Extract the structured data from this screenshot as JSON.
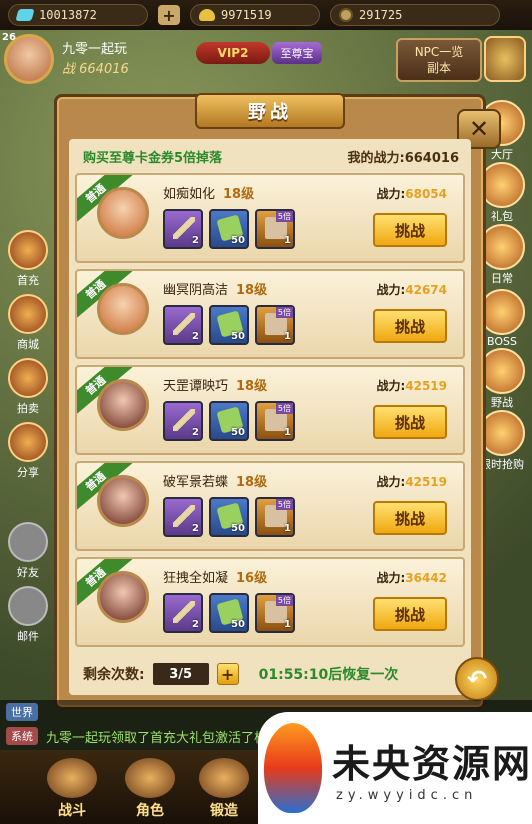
{
  "topbar": {
    "gems": "10013872",
    "gold": "9971519",
    "copper": "291725"
  },
  "player": {
    "level": "26",
    "name": "九零一起玩",
    "power": "战 664016",
    "vip": "VIP2",
    "zhizun": "至尊宝"
  },
  "npc": {
    "line1": "NPC一览",
    "line2": "副本"
  },
  "left_menu": [
    "首充",
    "商城",
    "拍卖",
    "分享",
    "好友",
    "邮件"
  ],
  "right_menu": [
    "大厅",
    "礼包",
    "日常",
    "BOSS",
    "野战",
    "限时抢购"
  ],
  "dialog": {
    "title": "野战",
    "promo": "购买至尊卡金券5倍掉落",
    "my_power_label": "我的战力:",
    "my_power": "664016",
    "badge": "普通",
    "power_label": "战力:",
    "button": "挑战",
    "opponents": [
      {
        "name": "如痴如化",
        "level": "18级",
        "power": "68054",
        "items": [
          "2",
          "50",
          "1"
        ]
      },
      {
        "name": "幽冥阴高洁",
        "level": "18级",
        "power": "42674",
        "items": [
          "2",
          "50",
          "1"
        ]
      },
      {
        "name": "天罡谭映巧",
        "level": "18级",
        "power": "42519",
        "items": [
          "2",
          "50",
          "1"
        ]
      },
      {
        "name": "破军景若蝶",
        "level": "18级",
        "power": "42519",
        "items": [
          "2",
          "50",
          "1"
        ]
      },
      {
        "name": "狂拽全如凝",
        "level": "16级",
        "power": "36442",
        "items": [
          "2",
          "50",
          "1"
        ]
      }
    ],
    "item_tag": "5倍",
    "remaining_label": "剩余次数:",
    "remaining": "3/5",
    "timer": "01:55:10后恢复一次"
  },
  "chat": {
    "world": "世界",
    "system": "系统",
    "message": "九零一起玩领取了首充大礼包激活了极品时装"
  },
  "bottom": [
    "战斗",
    "角色",
    "锻造"
  ],
  "watermark": {
    "title": "未央资源网",
    "url": "zy.wyyidc.cn"
  }
}
